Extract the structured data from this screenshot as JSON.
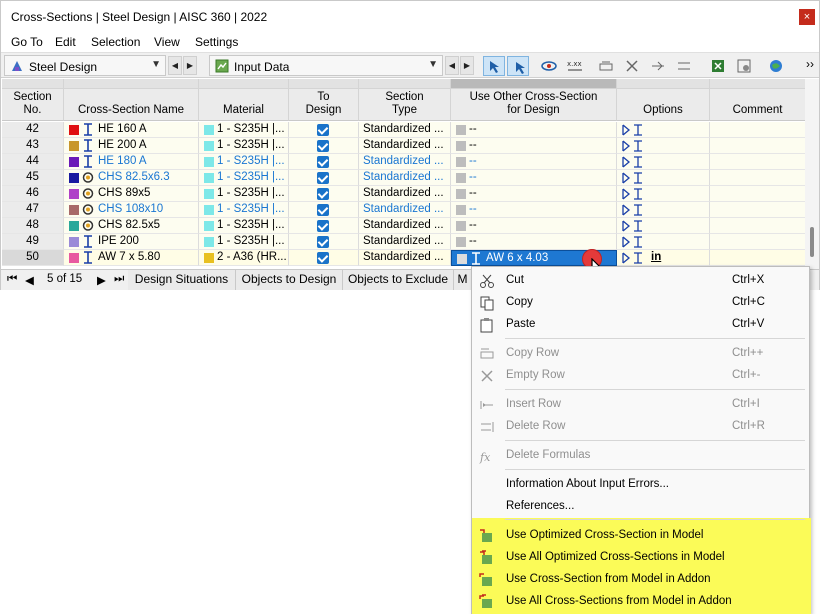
{
  "window": {
    "title": "Cross-Sections | Steel Design | AISC 360 | 2022",
    "close": "×"
  },
  "menu": [
    "Go To",
    "Edit",
    "Selection",
    "View",
    "Settings"
  ],
  "toolbar": {
    "module": "Steel Design",
    "table": "Input Data",
    "overflow": "››"
  },
  "headers": {
    "section_no": [
      "Section",
      "No."
    ],
    "name": "Cross-Section Name",
    "material": "Material",
    "to_design": [
      "To",
      "Design"
    ],
    "section_type": [
      "Section",
      "Type"
    ],
    "use_other": [
      "Use Other Cross-Section",
      "for Design"
    ],
    "options": "Options",
    "comment": "Comment"
  },
  "rows": [
    {
      "no": "42",
      "color": "#e01010",
      "shape": "I",
      "name": "HE 160 A",
      "blue": false,
      "mat_color": "#7de8e8",
      "material": "1 - S235H |...",
      "type": "Standardized ...",
      "other": "--"
    },
    {
      "no": "43",
      "color": "#c8962a",
      "shape": "I",
      "name": "HE 200 A",
      "blue": false,
      "mat_color": "#7de8e8",
      "material": "1 - S235H |...",
      "type": "Standardized ...",
      "other": "--"
    },
    {
      "no": "44",
      "color": "#6a1ab8",
      "shape": "I",
      "name": "HE 180 A",
      "blue": true,
      "mat_color": "#7de8e8",
      "material": "1 - S235H |...",
      "type": "Standardized ...",
      "other": "--"
    },
    {
      "no": "45",
      "color": "#1a1aa0",
      "shape": "O",
      "name": "CHS 82.5x6.3",
      "blue": true,
      "mat_color": "#7de8e8",
      "material": "1 - S235H |...",
      "type": "Standardized ...",
      "other": "--"
    },
    {
      "no": "46",
      "color": "#b040c8",
      "shape": "O",
      "name": "CHS 89x5",
      "blue": false,
      "mat_color": "#7de8e8",
      "material": "1 - S235H |...",
      "type": "Standardized ...",
      "other": "--"
    },
    {
      "no": "47",
      "color": "#a86a6a",
      "shape": "O",
      "name": "CHS 108x10",
      "blue": true,
      "mat_color": "#7de8e8",
      "material": "1 - S235H |...",
      "type": "Standardized ...",
      "other": "--"
    },
    {
      "no": "48",
      "color": "#2aa89a",
      "shape": "O",
      "name": "CHS 82.5x5",
      "blue": false,
      "mat_color": "#7de8e8",
      "material": "1 - S235H |...",
      "type": "Standardized ...",
      "other": "--"
    },
    {
      "no": "49",
      "color": "#9a8ad8",
      "shape": "I",
      "name": "IPE 200",
      "blue": false,
      "mat_color": "#7de8e8",
      "material": "1 - S235H |...",
      "type": "Standardized ...",
      "other": "--"
    },
    {
      "no": "50",
      "color": "#e85aa0",
      "shape": "I",
      "name": "AW 7 x 5.80",
      "blue": false,
      "mat_color": "#e8c020",
      "material": "2 - A36 (HR...",
      "type": "Standardized ...",
      "other": "AW 6 x 4.03"
    }
  ],
  "tabs": {
    "page": "5 of 15",
    "items": [
      "Design Situations",
      "Objects to Design",
      "Objects to Exclude",
      "M"
    ]
  },
  "context_menu": {
    "cut": "Cut",
    "cut_sc": "Ctrl+X",
    "copy": "Copy",
    "copy_sc": "Ctrl+C",
    "paste": "Paste",
    "paste_sc": "Ctrl+V",
    "copy_row": "Copy Row",
    "copy_row_sc": "Ctrl++",
    "empty_row": "Empty Row",
    "empty_row_sc": "Ctrl+-",
    "insert_row": "Insert Row",
    "insert_row_sc": "Ctrl+I",
    "delete_row": "Delete Row",
    "delete_row_sc": "Ctrl+R",
    "delete_formulas": "Delete Formulas",
    "info_errors": "Information About Input Errors...",
    "references": "References...",
    "use_optimized": "Use Optimized Cross-Section in Model",
    "use_all_optimized": "Use All Optimized Cross-Sections in Model",
    "use_from_model": "Use Cross-Section from Model in Addon",
    "use_all_from_model": "Use All Cross-Sections from Model in Addon"
  },
  "colors": {
    "highlight": "#fbfb58",
    "accent": "#1a73c9",
    "selection": "#1e78d2"
  }
}
